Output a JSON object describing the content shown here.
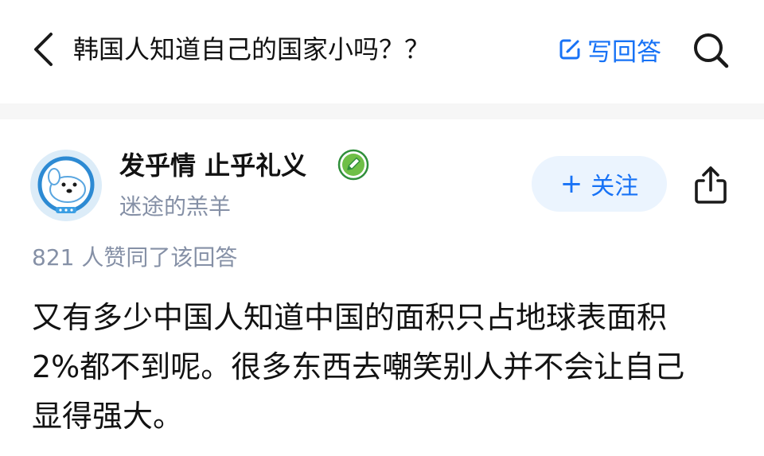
{
  "header": {
    "title": "韩国人知道自己的国家小吗？？",
    "write_answer_label": "写回答",
    "icons": {
      "back": "chevron-left-icon",
      "edit": "edit-icon",
      "search": "search-icon"
    },
    "accent_color": "#1772f6"
  },
  "author": {
    "name": "发乎情 止乎礼义",
    "bio": "迷途的羔羊",
    "avatar_icon": "cartoon-avatar",
    "badge_icon": "verified-badge-icon",
    "follow_label": "关注",
    "follow_plus": "+",
    "share_icon": "share-icon"
  },
  "answer": {
    "votes_text": "821 人赞同了该回答",
    "lines": [
      "又有多少中国人知道中国的面积只占地球表面积",
      "2%都不到呢。很多东西去嘲笑别人并不会让自己",
      "显得强大。"
    ]
  }
}
